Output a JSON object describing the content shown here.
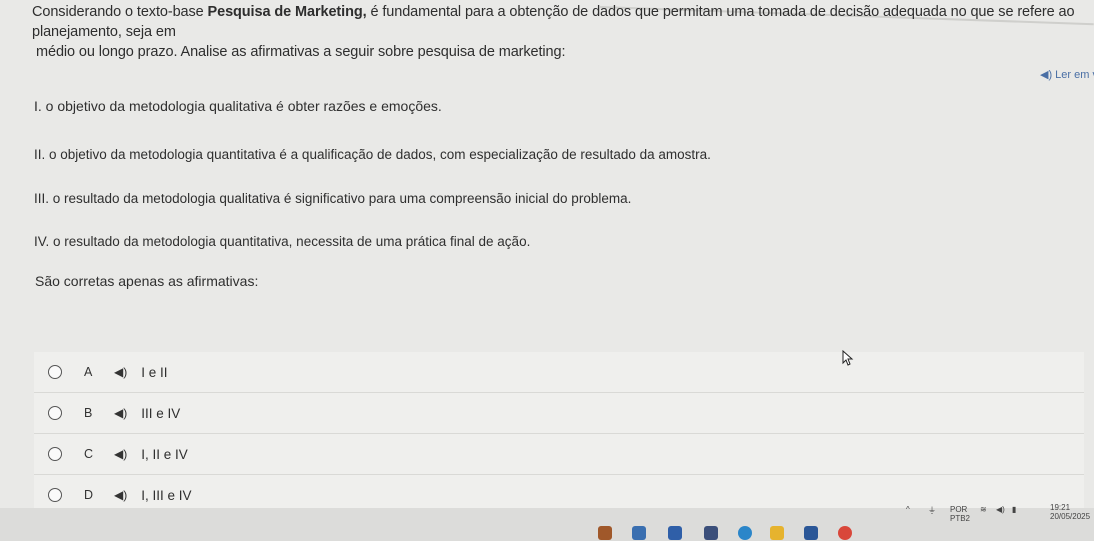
{
  "question": {
    "intro_part1": "Considerando o texto-base ",
    "intro_bold": "Pesquisa de Marketing,",
    "intro_part2": " é fundamental para a obtenção de dados que permitam uma tomada de decisão adequada no que se refere ao planejamento, seja em",
    "intro_line2": "médio ou longo prazo. Analise as afirmativas a seguir sobre pesquisa de marketing:",
    "read_aloud_label": "◀) Ler em v",
    "statements": [
      "I. o objetivo da metodologia qualitativa é obter razões e emoções.",
      "II. o objetivo da metodologia quantitativa é a qualificação de dados, com especialização de resultado da amostra.",
      "III. o resultado da metodologia qualitativa é significativo para uma compreensão inicial do problema.",
      "IV. o resultado da metodologia quantitativa, necessita de uma prática final de ação."
    ],
    "prompt": "São corretas apenas as afirmativas:"
  },
  "options": [
    {
      "letter": "A",
      "text": "I e II"
    },
    {
      "letter": "B",
      "text": "III e IV"
    },
    {
      "letter": "C",
      "text": "I, II e IV"
    },
    {
      "letter": "D",
      "text": "I, III e IV"
    }
  ],
  "taskbar": {
    "language": "POR",
    "language_sub": "PTB2",
    "time": "19:21",
    "date": "20/05/2025"
  },
  "colors": {
    "background": "#e9e9e7",
    "option_background": "#efefed",
    "text": "#2b2b2b"
  }
}
